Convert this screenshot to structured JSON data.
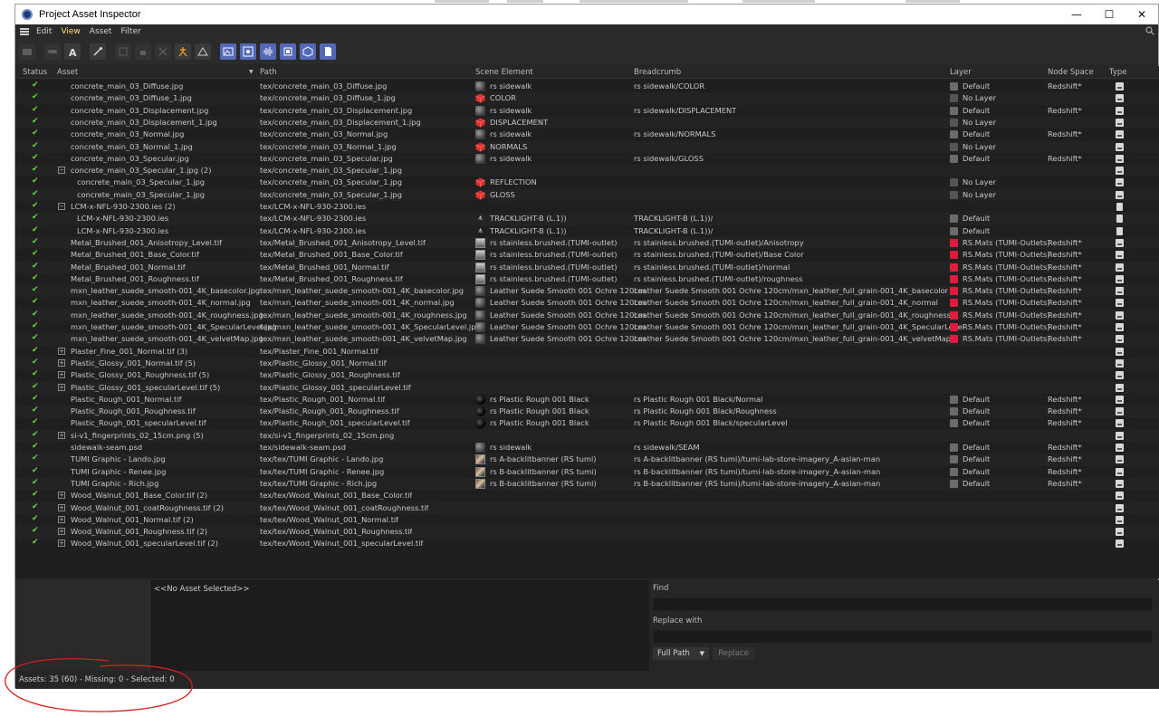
{
  "window": {
    "title": "Project Asset Inspector",
    "controls": {
      "minimize": "—",
      "maximize": "☐",
      "close": "✕"
    }
  },
  "menubar": {
    "items": [
      "Edit",
      "View",
      "Asset",
      "Filter"
    ],
    "active": "View"
  },
  "table": {
    "columns": [
      "Status",
      "Asset",
      "Path",
      "Scene Element",
      "Breadcrumb",
      "Layer",
      "Node Space",
      "Type"
    ],
    "rows": [
      {
        "asset": "concrete_main_03_Diffuse.jpg",
        "path": "tex/concrete_main_03_Diffuse.jpg",
        "element": "rs sidewalk",
        "icon": "sphere",
        "breadcrumb": "rs sidewalk/COLOR",
        "layer": "Default",
        "layer_kind": "default",
        "nodespace": "Redshift*",
        "type": "image",
        "indent": 0,
        "expander": ""
      },
      {
        "asset": "concrete_main_03_Diffuse_1.jpg",
        "path": "tex/concrete_main_03_Diffuse_1.jpg",
        "element": "COLOR",
        "icon": "cube",
        "breadcrumb": "",
        "layer": "No Layer",
        "layer_kind": "nolayer",
        "nodespace": "",
        "type": "image",
        "indent": 0,
        "expander": ""
      },
      {
        "asset": "concrete_main_03_Displacement.jpg",
        "path": "tex/concrete_main_03_Displacement.jpg",
        "element": "rs sidewalk",
        "icon": "sphere",
        "breadcrumb": "rs sidewalk/DISPLACEMENT",
        "layer": "Default",
        "layer_kind": "default",
        "nodespace": "Redshift*",
        "type": "image",
        "indent": 0,
        "expander": ""
      },
      {
        "asset": "concrete_main_03_Displacement_1.jpg",
        "path": "tex/concrete_main_03_Displacement_1.jpg",
        "element": "DISPLACEMENT",
        "icon": "cube",
        "breadcrumb": "",
        "layer": "No Layer",
        "layer_kind": "nolayer",
        "nodespace": "",
        "type": "image",
        "indent": 0,
        "expander": ""
      },
      {
        "asset": "concrete_main_03_Normal.jpg",
        "path": "tex/concrete_main_03_Normal.jpg",
        "element": "rs sidewalk",
        "icon": "sphere",
        "breadcrumb": "rs sidewalk/NORMALS",
        "layer": "Default",
        "layer_kind": "default",
        "nodespace": "Redshift*",
        "type": "image",
        "indent": 0,
        "expander": ""
      },
      {
        "asset": "concrete_main_03_Normal_1.jpg",
        "path": "tex/concrete_main_03_Normal_1.jpg",
        "element": "NORMALS",
        "icon": "cube",
        "breadcrumb": "",
        "layer": "No Layer",
        "layer_kind": "nolayer",
        "nodespace": "",
        "type": "image",
        "indent": 0,
        "expander": ""
      },
      {
        "asset": "concrete_main_03_Specular.jpg",
        "path": "tex/concrete_main_03_Specular.jpg",
        "element": "rs sidewalk",
        "icon": "sphere",
        "breadcrumb": "rs sidewalk/GLOSS",
        "layer": "Default",
        "layer_kind": "default",
        "nodespace": "Redshift*",
        "type": "image",
        "indent": 0,
        "expander": ""
      },
      {
        "asset": "concrete_main_03_Specular_1.jpg (2)",
        "path": "tex/concrete_main_03_Specular_1.jpg",
        "element": "",
        "icon": "",
        "breadcrumb": "",
        "layer": "",
        "layer_kind": "",
        "nodespace": "",
        "type": "image",
        "indent": 0,
        "expander": "−"
      },
      {
        "asset": "concrete_main_03_Specular_1.jpg",
        "path": "tex/concrete_main_03_Specular_1.jpg",
        "element": "REFLECTION",
        "icon": "cube",
        "breadcrumb": "",
        "layer": "No Layer",
        "layer_kind": "nolayer",
        "nodespace": "",
        "type": "image",
        "indent": 1,
        "expander": ""
      },
      {
        "asset": "concrete_main_03_Specular_1.jpg",
        "path": "tex/concrete_main_03_Specular_1.jpg",
        "element": "GLOSS",
        "icon": "cube",
        "breadcrumb": "",
        "layer": "No Layer",
        "layer_kind": "nolayer",
        "nodespace": "",
        "type": "image",
        "indent": 1,
        "expander": ""
      },
      {
        "asset": "LCM-x-NFL-930-2300.ies (2)",
        "path": "tex/LCM-x-NFL-930-2300.ies",
        "element": "",
        "icon": "",
        "breadcrumb": "",
        "layer": "",
        "layer_kind": "",
        "nodespace": "",
        "type": "doc",
        "indent": 0,
        "expander": "−"
      },
      {
        "asset": "LCM-x-NFL-930-2300.ies",
        "path": "tex/LCM-x-NFL-930-2300.ies",
        "element": "TRACKLIGHT-B (L.1))",
        "icon": "lamp",
        "breadcrumb": "TRACKLIGHT-B (L.1))/",
        "layer": "Default",
        "layer_kind": "default",
        "nodespace": "",
        "type": "doc",
        "indent": 1,
        "expander": ""
      },
      {
        "asset": "LCM-x-NFL-930-2300.ies",
        "path": "tex/LCM-x-NFL-930-2300.ies",
        "element": "TRACKLIGHT-B (L.1))",
        "icon": "lamp",
        "breadcrumb": "TRACKLIGHT-B (L.1))/",
        "layer": "Default",
        "layer_kind": "default",
        "nodespace": "",
        "type": "doc",
        "indent": 1,
        "expander": ""
      },
      {
        "asset": "Metal_Brushed_001_Anisotropy_Level.tif",
        "path": "tex/Metal_Brushed_001_Anisotropy_Level.tif",
        "element": "rs stainless.brushed.(TUMI-outlet)",
        "icon": "stain",
        "breadcrumb": "rs stainless.brushed.(TUMI-outlet)/Anisotropy",
        "layer": "RS.Mats (TUMI-Outlets)",
        "layer_kind": "red",
        "nodespace": "Redshift*",
        "type": "image",
        "indent": 0,
        "expander": ""
      },
      {
        "asset": "Metal_Brushed_001_Base_Color.tif",
        "path": "tex/Metal_Brushed_001_Base_Color.tif",
        "element": "rs stainless.brushed.(TUMI-outlet)",
        "icon": "stain",
        "breadcrumb": "rs stainless.brushed.(TUMI-outlet)/Base Color",
        "layer": "RS.Mats (TUMI-Outlets)",
        "layer_kind": "red",
        "nodespace": "Redshift*",
        "type": "image",
        "indent": 0,
        "expander": ""
      },
      {
        "asset": "Metal_Brushed_001_Normal.tif",
        "path": "tex/Metal_Brushed_001_Normal.tif",
        "element": "rs stainless.brushed.(TUMI-outlet)",
        "icon": "stain",
        "breadcrumb": "rs stainless.brushed.(TUMI-outlet)/normal",
        "layer": "RS.Mats (TUMI-Outlets)",
        "layer_kind": "red",
        "nodespace": "Redshift*",
        "type": "image",
        "indent": 0,
        "expander": ""
      },
      {
        "asset": "Metal_Brushed_001_Roughness.tif",
        "path": "tex/Metal_Brushed_001_Roughness.tif",
        "element": "rs stainless.brushed.(TUMI-outlet)",
        "icon": "stain",
        "breadcrumb": "rs stainless.brushed.(TUMI-outlet)/roughness",
        "layer": "RS.Mats (TUMI-Outlets)",
        "layer_kind": "red",
        "nodespace": "Redshift*",
        "type": "image",
        "indent": 0,
        "expander": ""
      },
      {
        "asset": "mxn_leather_suede_smooth-001_4K_basecolor.jpg",
        "path": "tex/mxn_leather_suede_smooth-001_4K_basecolor.jpg",
        "element": "Leather Suede Smooth 001 Ochre 120cm",
        "icon": "sphere",
        "breadcrumb": "Leather Suede Smooth 001 Ochre 120cm/mxn_leather_full_grain-001_4K_basecolor",
        "layer": "RS.Mats (TUMI-Outlets)",
        "layer_kind": "red",
        "nodespace": "Redshift*",
        "type": "image",
        "indent": 0,
        "expander": ""
      },
      {
        "asset": "mxn_leather_suede_smooth-001_4K_normal.jpg",
        "path": "tex/mxn_leather_suede_smooth-001_4K_normal.jpg",
        "element": "Leather Suede Smooth 001 Ochre 120cm",
        "icon": "sphere",
        "breadcrumb": "Leather Suede Smooth 001 Ochre 120cm/mxn_leather_full_grain-001_4K_normal",
        "layer": "RS.Mats (TUMI-Outlets)",
        "layer_kind": "red",
        "nodespace": "Redshift*",
        "type": "image",
        "indent": 0,
        "expander": ""
      },
      {
        "asset": "mxn_leather_suede_smooth-001_4K_roughness.jpg",
        "path": "tex/mxn_leather_suede_smooth-001_4K_roughness.jpg",
        "element": "Leather Suede Smooth 001 Ochre 120cm",
        "icon": "sphere",
        "breadcrumb": "Leather Suede Smooth 001 Ochre 120cm/mxn_leather_full_grain-001_4K_roughness",
        "layer": "RS.Mats (TUMI-Outlets)",
        "layer_kind": "red",
        "nodespace": "Redshift*",
        "type": "image",
        "indent": 0,
        "expander": ""
      },
      {
        "asset": "mxn_leather_suede_smooth-001_4K_SpecularLevel.jpg",
        "path": "tex/mxn_leather_suede_smooth-001_4K_SpecularLevel.jpg",
        "element": "Leather Suede Smooth 001 Ochre 120cm",
        "icon": "sphere",
        "breadcrumb": "Leather Suede Smooth 001 Ochre 120cm/mxn_leather_full_grain-001_4K_SpecularLevel",
        "layer": "RS.Mats (TUMI-Outlets)",
        "layer_kind": "red",
        "nodespace": "Redshift*",
        "type": "image",
        "indent": 0,
        "expander": ""
      },
      {
        "asset": "mxn_leather_suede_smooth-001_4K_velvetMap.jpg",
        "path": "tex/mxn_leather_suede_smooth-001_4K_velvetMap.jpg",
        "element": "Leather Suede Smooth 001 Ochre 120cm",
        "icon": "sphere",
        "breadcrumb": "Leather Suede Smooth 001 Ochre 120cm/mxn_leather_full_grain-001_4K_velvetMap",
        "layer": "RS.Mats (TUMI-Outlets)",
        "layer_kind": "red",
        "nodespace": "Redshift*",
        "type": "image",
        "indent": 0,
        "expander": ""
      },
      {
        "asset": "Plaster_Fine_001_Normal.tif (3)",
        "path": "tex/Plaster_Fine_001_Normal.tif",
        "element": "",
        "icon": "",
        "breadcrumb": "",
        "layer": "",
        "layer_kind": "",
        "nodespace": "",
        "type": "image",
        "indent": 0,
        "expander": "+"
      },
      {
        "asset": "Plastic_Glossy_001_Normal.tif (5)",
        "path": "tex/Plastic_Glossy_001_Normal.tif",
        "element": "",
        "icon": "",
        "breadcrumb": "",
        "layer": "",
        "layer_kind": "",
        "nodespace": "",
        "type": "image",
        "indent": 0,
        "expander": "+"
      },
      {
        "asset": "Plastic_Glossy_001_Roughness.tif (5)",
        "path": "tex/Plastic_Glossy_001_Roughness.tif",
        "element": "",
        "icon": "",
        "breadcrumb": "",
        "layer": "",
        "layer_kind": "",
        "nodespace": "",
        "type": "image",
        "indent": 0,
        "expander": "+"
      },
      {
        "asset": "Plastic_Glossy_001_specularLevel.tif (5)",
        "path": "tex/Plastic_Glossy_001_specularLevel.tif",
        "element": "",
        "icon": "",
        "breadcrumb": "",
        "layer": "",
        "layer_kind": "",
        "nodespace": "",
        "type": "image",
        "indent": 0,
        "expander": "+"
      },
      {
        "asset": "Plastic_Rough_001_Normal.tif",
        "path": "tex/Plastic_Rough_001_Normal.tif",
        "element": "rs Plastic Rough 001 Black",
        "icon": "black",
        "breadcrumb": "rs Plastic Rough 001 Black/Normal",
        "layer": "Default",
        "layer_kind": "default",
        "nodespace": "Redshift*",
        "type": "image",
        "indent": 0,
        "expander": ""
      },
      {
        "asset": "Plastic_Rough_001_Roughness.tif",
        "path": "tex/Plastic_Rough_001_Roughness.tif",
        "element": "rs Plastic Rough 001 Black",
        "icon": "black",
        "breadcrumb": "rs Plastic Rough 001 Black/Roughness",
        "layer": "Default",
        "layer_kind": "default",
        "nodespace": "Redshift*",
        "type": "image",
        "indent": 0,
        "expander": ""
      },
      {
        "asset": "Plastic_Rough_001_specularLevel.tif",
        "path": "tex/Plastic_Rough_001_specularLevel.tif",
        "element": "rs Plastic Rough 001 Black",
        "icon": "black",
        "breadcrumb": "rs Plastic Rough 001 Black/specularLevel",
        "layer": "Default",
        "layer_kind": "default",
        "nodespace": "Redshift*",
        "type": "image",
        "indent": 0,
        "expander": ""
      },
      {
        "asset": "si-v1_fingerprints_02_15cm.png (5)",
        "path": "tex/si-v1_fingerprints_02_15cm.png",
        "element": "",
        "icon": "",
        "breadcrumb": "",
        "layer": "",
        "layer_kind": "",
        "nodespace": "",
        "type": "image",
        "indent": 0,
        "expander": "+"
      },
      {
        "asset": "sidewalk-seam.psd",
        "path": "tex/sidewalk-seam.psd",
        "element": "rs sidewalk",
        "icon": "sphere",
        "breadcrumb": "rs sidewalk/SEAM",
        "layer": "Default",
        "layer_kind": "default",
        "nodespace": "Redshift*",
        "type": "image",
        "indent": 0,
        "expander": ""
      },
      {
        "asset": "TUMI Graphic - Lando.jpg",
        "path": "tex/tex/TUMI Graphic - Lando.jpg",
        "element": "rs A-backlitbanner (RS tumi)",
        "icon": "img",
        "breadcrumb": "rs A-backlitbanner (RS tumi)/tumi-lab-store-imagery_A-asian-man",
        "layer": "Default",
        "layer_kind": "default",
        "nodespace": "Redshift*",
        "type": "image",
        "indent": 0,
        "expander": ""
      },
      {
        "asset": "TUMI Graphic - Renee.jpg",
        "path": "tex/tex/TUMI Graphic - Renee.jpg",
        "element": "rs B-backlitbanner (RS tumi)",
        "icon": "img",
        "breadcrumb": "rs B-backlitbanner (RS tumi)/tumi-lab-store-imagery_A-asian-man",
        "layer": "Default",
        "layer_kind": "default",
        "nodespace": "Redshift*",
        "type": "image",
        "indent": 0,
        "expander": ""
      },
      {
        "asset": "TUMI Graphic - Rich.jpg",
        "path": "tex/tex/TUMI Graphic - Rich.jpg",
        "element": "rs B-backlitbanner (RS tumi)",
        "icon": "img",
        "breadcrumb": "rs B-backlitbanner (RS tumi)/tumi-lab-store-imagery_A-asian-man",
        "layer": "Default",
        "layer_kind": "default",
        "nodespace": "Redshift*",
        "type": "image",
        "indent": 0,
        "expander": ""
      },
      {
        "asset": "Wood_Walnut_001_Base_Color.tif (2)",
        "path": "tex/tex/Wood_Walnut_001_Base_Color.tif",
        "element": "",
        "icon": "",
        "breadcrumb": "",
        "layer": "",
        "layer_kind": "",
        "nodespace": "",
        "type": "image",
        "indent": 0,
        "expander": "+"
      },
      {
        "asset": "Wood_Walnut_001_coatRoughness.tif (2)",
        "path": "tex/tex/Wood_Walnut_001_coatRoughness.tif",
        "element": "",
        "icon": "",
        "breadcrumb": "",
        "layer": "",
        "layer_kind": "",
        "nodespace": "",
        "type": "image",
        "indent": 0,
        "expander": "+"
      },
      {
        "asset": "Wood_Walnut_001_Normal.tif (2)",
        "path": "tex/tex/Wood_Walnut_001_Normal.tif",
        "element": "",
        "icon": "",
        "breadcrumb": "",
        "layer": "",
        "layer_kind": "",
        "nodespace": "",
        "type": "image",
        "indent": 0,
        "expander": "+"
      },
      {
        "asset": "Wood_Walnut_001_Roughness.tif (2)",
        "path": "tex/tex/Wood_Walnut_001_Roughness.tif",
        "element": "",
        "icon": "",
        "breadcrumb": "",
        "layer": "",
        "layer_kind": "",
        "nodespace": "",
        "type": "image",
        "indent": 0,
        "expander": "+"
      },
      {
        "asset": "Wood_Walnut_001_specularLevel.tif (2)",
        "path": "tex/tex/Wood_Walnut_001_specularLevel.tif",
        "element": "",
        "icon": "",
        "breadcrumb": "",
        "layer": "",
        "layer_kind": "",
        "nodespace": "",
        "type": "image",
        "indent": 0,
        "expander": "+"
      }
    ]
  },
  "info": {
    "no_asset": "<<No Asset Selected>>"
  },
  "find": {
    "find_label": "Find",
    "find_value": "",
    "replace_label": "Replace with",
    "replace_value": "",
    "mode": "Full Path",
    "replace_button": "Replace"
  },
  "status": {
    "text": "Assets: 35 (60) - Missing: 0 - Selected: 0"
  },
  "colors": {
    "check": "#6ed24a",
    "accent": "#5468b8",
    "red_layer": "#e01c3c",
    "annotation": "#d81e1e",
    "cube": "#e03030"
  }
}
